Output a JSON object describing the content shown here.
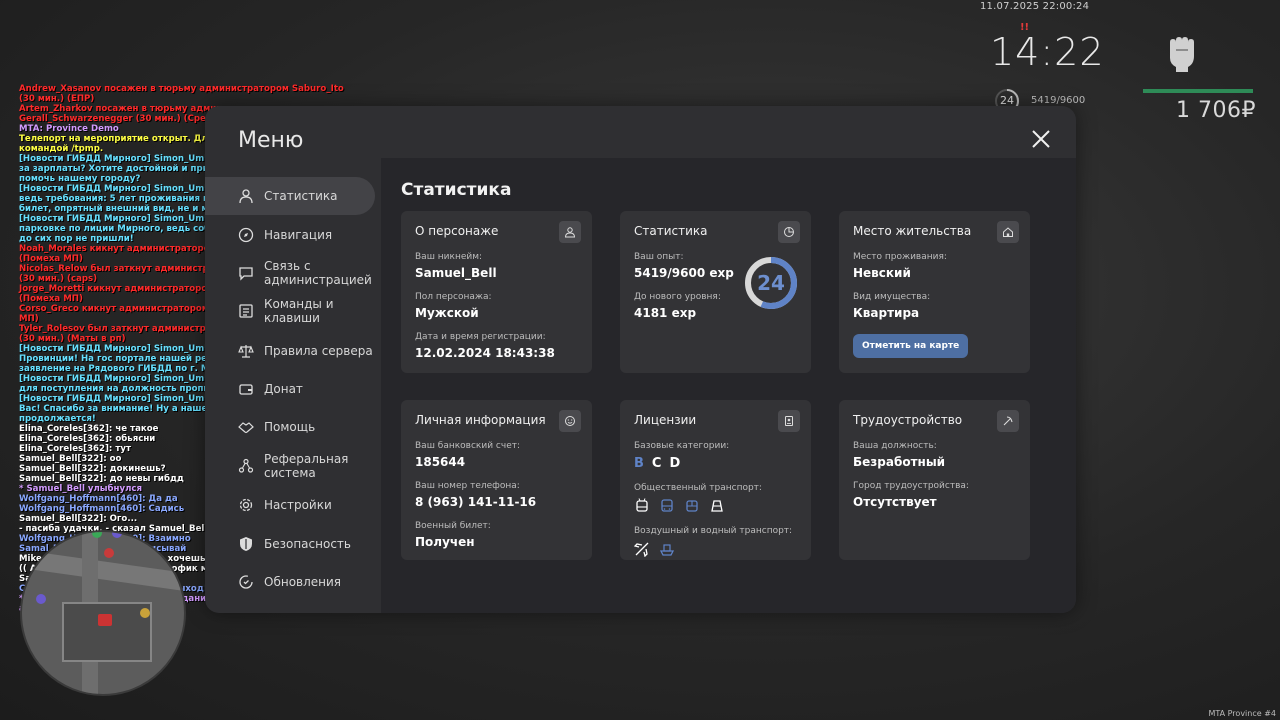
{
  "hud": {
    "datetime": "11.07.2025 22:00:24",
    "alert": "!!",
    "time": "14:22",
    "level": "24",
    "exp": "5419/9600",
    "money": "1 706₽"
  },
  "footer": "MTA Province #4",
  "chat": [
    {
      "text": "Andrew_Xasanov посажен в тюрьму администратором Saburo_Ito (30 мин.) (ЕПР)",
      "color": "#ff2a2a"
    },
    {
      "text": "Artem_Zharkov посажен в тюрьму администратором Gerall_Schwarzenegger (30 мин.) (Срез)",
      "color": "#ff2a2a"
    },
    {
      "text": "MTA: Province Demo",
      "color": "#d39cff"
    },
    {
      "text": "Телепорт на мероприятие открыт. Для участия воспользуйтесь командой /tpmp.",
      "color": "#ffff44"
    },
    {
      "text": "[Новости ГИБДД Мирного] Simon_Umbrella: Ужасно беспокоитесь за зарплаты? Хотите достойной и приятной работы? Хотите помочь нашему городу?",
      "color": "#66e0ff"
    },
    {
      "text": "[Новости ГИБДД Мирного] Simon_Umbrella: Тогда Вам к нам, ведь требования: 5 лет проживания в республике, военный билет, опрятный внешний вид, не и меть штрафов.",
      "color": "#66e0ff"
    },
    {
      "text": "[Новости ГИБДД Мирного] Simon_Umbrella: Ждём именно Вас на парковке по лиции Мирного, ведь собеседование уже идет, а Вы до сих пор не пришли!",
      "color": "#66e0ff"
    },
    {
      "text": "Noah_Morales кикнут администратором Matthew_Esposito (Помеха МП)",
      "color": "#ff2a2a"
    },
    {
      "text": "Nicolas_Relow был заткнут администратором Matthew_Esposito (30 мин.) (caps)",
      "color": "#ff2a2a"
    },
    {
      "text": "Jorge_Moretti кикнут администратором Matthew_Esposito (Помеха МП)",
      "color": "#ff2a2a"
    },
    {
      "text": "Corso_Greco кикнут администратором Matthew_Esposito (Помеха МП)",
      "color": "#ff2a2a"
    },
    {
      "text": "Tyler_Rolesov был заткнут администратором Anthony_Manrique (30 мин.) (Маты в рп)",
      "color": "#ff2a2a"
    },
    {
      "text": "[Новости ГИБДД Мирного] Simon_Umbrella: Дорогие жители Провинции! На гос портале нашей республики открыто заявление на Рядового ГИБДД по г. Мирный.",
      "color": "#66e0ff"
    },
    {
      "text": "[Новости ГИБДД Мирного] Simon_Umbrella: Все нужные критерии для поступления на должность прописаны там же, на портале.",
      "color": "#66e0ff"
    },
    {
      "text": "[Новости ГИБДД Мирного] Simon_Umbrella: Мы ждём именно Вас! Спасибо за внимание! Ну а наше собеседование продолжается!",
      "color": "#66e0ff"
    },
    {
      "text": "Elina_Coreles[362]: че такое",
      "color": "#ffffff"
    },
    {
      "text": "Elina_Coreles[362]: обьясни",
      "color": "#ffffff"
    },
    {
      "text": "Elina_Coreles[362]: тут",
      "color": "#ffffff"
    },
    {
      "text": "Samuel_Bell[322]: оо",
      "color": "#ffffff"
    },
    {
      "text": "Samuel_Bell[322]: докинешь?",
      "color": "#ffffff"
    },
    {
      "text": "Samuel_Bell[322]: до невы гибдд",
      "color": "#ffffff"
    },
    {
      "text": "* Samuel_Bell улыбнулся",
      "color": "#d39cff"
    },
    {
      "text": "Wolfgang_Hoffmann[460]: Да да",
      "color": "#8aa8ff"
    },
    {
      "text": "Wolfgang_Hoffmann[460]: Садись",
      "color": "#8aa8ff"
    },
    {
      "text": "Samuel_Bell[322]: Ого...",
      "color": "#ffffff"
    },
    {
      "text": "- пасиба удачки, - сказал Samuel_Bell, улыбнувшись.",
      "color": "#ffffff"
    },
    {
      "text": "Wolfgang_Hoffmann[460]: Взаимно",
      "color": "#8aa8ff"
    },
    {
      "text": "Samal_McCarthy[278]: выписывай",
      "color": "#8aa8ff"
    },
    {
      "text": "Mike_Zlatogorsky[82]: никита хочешь к нам в оргу",
      "color": "#ffffff"
    },
    {
      "text": "(( Artem_Shelt[324]: Откат, и пофик мне что ты там скажешь! ))",
      "color": "#ffffff"
    },
    {
      "text": "Samuel_Bell[322]: ого",
      "color": "#ffffff"
    },
    {
      "text": "Connor_Lascano[434]: Пора на выход!",
      "color": "#8aa8ff"
    },
    {
      "text": "* Connor_Lascano вытащил гражданина из служебного автомобиля",
      "color": "#d39cff"
    }
  ],
  "menu": {
    "title": "Меню",
    "items": [
      {
        "label": "Статистика",
        "icon": "user-icon"
      },
      {
        "label": "Навигация",
        "icon": "compass-icon"
      },
      {
        "label": "Связь с администрацией",
        "icon": "chat-icon"
      },
      {
        "label": "Команды и клавиши",
        "icon": "list-icon"
      },
      {
        "label": "Правила сервера",
        "icon": "scales-icon"
      },
      {
        "label": "Донат",
        "icon": "wallet-icon"
      },
      {
        "label": "Помощь",
        "icon": "handshake-icon"
      },
      {
        "label": "Реферальная система",
        "icon": "network-icon"
      },
      {
        "label": "Настройки",
        "icon": "gear-icon"
      },
      {
        "label": "Безопасность",
        "icon": "shield-icon"
      },
      {
        "label": "Обновления",
        "icon": "refresh-icon"
      }
    ]
  },
  "content": {
    "title": "Статистика",
    "persona": {
      "title": "О персонаже",
      "nick_label": "Ваш никнейм:",
      "nick": "Samuel_Bell",
      "gender_label": "Пол персонажа:",
      "gender": "Мужской",
      "reg_label": "Дата и время регистрации:",
      "reg": "12.02.2024 18:43:38"
    },
    "stats": {
      "title": "Статистика",
      "exp_label": "Ваш опыт:",
      "exp": "5419/9600 exp",
      "next_label": "До нового уровня:",
      "next": "4181 exp",
      "level": "24",
      "progress": 0.5645
    },
    "residence": {
      "title": "Место жительства",
      "place_label": "Место проживания:",
      "place": "Невский",
      "property_label": "Вид имущества:",
      "property": "Квартира",
      "map_button": "Отметить на карте"
    },
    "personal": {
      "title": "Личная информация",
      "bank_label": "Ваш банковский счет:",
      "bank": "185644",
      "phone_label": "Ваш номер телефона:",
      "phone": "8 (963) 141-11-16",
      "military_label": "Военный билет:",
      "military": "Получен"
    },
    "licenses": {
      "title": "Лицензии",
      "base_label": "Базовые категории:",
      "categories": [
        {
          "label": "B",
          "active": true
        },
        {
          "label": "C",
          "active": false
        },
        {
          "label": "D",
          "active": false
        }
      ],
      "public_label": "Общественный транспорт:",
      "air_label": "Воздушный и водный транспорт:"
    },
    "job": {
      "title": "Трудоустройство",
      "position_label": "Ваша должность:",
      "position": "Безработный",
      "city_label": "Город трудоустройства:",
      "city": "Отсутствует"
    }
  },
  "colors": {
    "accent": "#5f83c7",
    "button": "#4e6fa3",
    "panel": "#2f2f32",
    "card": "#333336",
    "health": "#2e8b57"
  }
}
